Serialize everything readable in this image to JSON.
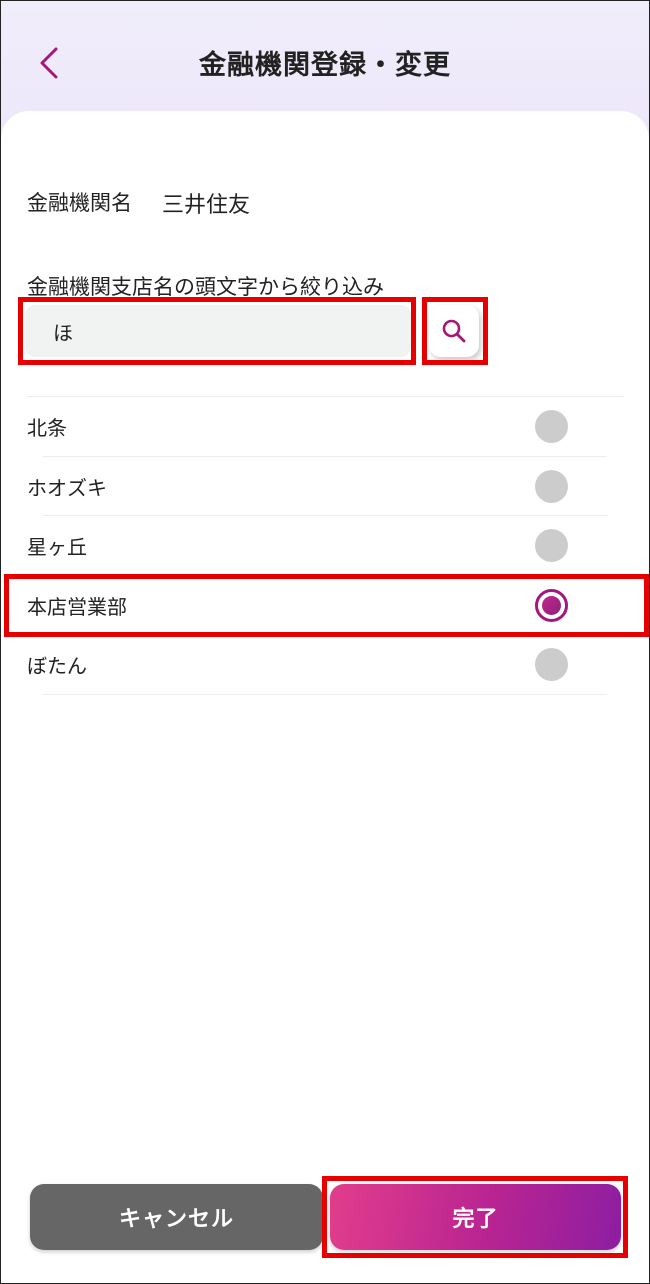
{
  "header": {
    "title": "金融機関登録・変更",
    "back_icon": "chevron-left-icon"
  },
  "bank": {
    "label": "金融機関名",
    "value": "三井住友"
  },
  "filter": {
    "label": "金融機関支店名の頭文字から絞り込み",
    "value": "ほ",
    "search_icon": "search-icon"
  },
  "branches": [
    {
      "name": "北条",
      "selected": false
    },
    {
      "name": "ホオズキ",
      "selected": false
    },
    {
      "name": "星ヶ丘",
      "selected": false
    },
    {
      "name": "本店営業部",
      "selected": true
    },
    {
      "name": "ぼたん",
      "selected": false
    }
  ],
  "footer": {
    "cancel_label": "キャンセル",
    "done_label": "完了"
  },
  "colors": {
    "accent": "#a3187a",
    "highlight": "#e60000",
    "cancel_bg": "#666666",
    "radio_unselected": "#cccccc"
  }
}
